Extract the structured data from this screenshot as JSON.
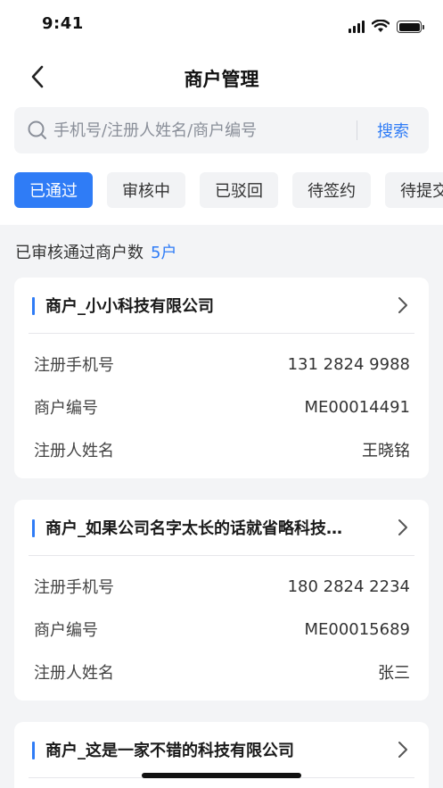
{
  "status_bar": {
    "time": "9:41"
  },
  "nav": {
    "title": "商户管理"
  },
  "search": {
    "placeholder": "手机号/注册人姓名/商户编号",
    "button_label": "搜索"
  },
  "tabs": [
    {
      "label": "已通过"
    },
    {
      "label": "审核中"
    },
    {
      "label": "已驳回"
    },
    {
      "label": "待签约"
    },
    {
      "label": "待提交"
    }
  ],
  "summary": {
    "label": "已审核通过商户数",
    "count": "5户"
  },
  "cards": [
    {
      "title": "商户_小小科技有限公司",
      "phone_label": "注册手机号",
      "phone": "131 2824 9988",
      "code_label": "商户编号",
      "code": "ME00014491",
      "name_label": "注册人姓名",
      "name": "王晓铭"
    },
    {
      "title": "商户_如果公司名字太长的话就省略科技…",
      "phone_label": "注册手机号",
      "phone": "180 2824 2234",
      "code_label": "商户编号",
      "code": "ME00015689",
      "name_label": "注册人姓名",
      "name": "张三"
    },
    {
      "title": "商户_这是一家不错的科技有限公司"
    }
  ],
  "colors": {
    "accent": "#2f7cf6",
    "background": "#f3f4f6"
  }
}
